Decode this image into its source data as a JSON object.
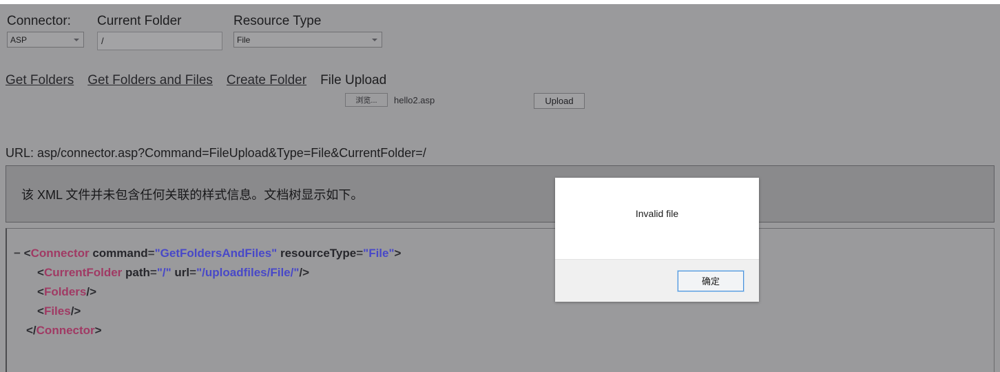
{
  "form": {
    "connector": {
      "label": "Connector:",
      "value": "ASP"
    },
    "current_folder": {
      "label": "Current Folder",
      "value": "/"
    },
    "resource_type": {
      "label": "Resource Type",
      "value": "File"
    }
  },
  "actions": {
    "get_folders": "Get Folders",
    "get_folders_and_files": "Get Folders and Files",
    "create_folder": "Create Folder",
    "file_upload_label": "File Upload",
    "browse_button": "浏览...",
    "selected_file": "hello2.asp",
    "upload_button": "Upload"
  },
  "url_line": "URL: asp/connector.asp?Command=FileUpload&Type=File&CurrentFolder=/",
  "xml_notice": "该 XML 文件并未包含任何关联的样式信息。文档树显示如下。",
  "xml": {
    "collapse_toggle": "−",
    "line1": {
      "open": "<",
      "tag": "Connector",
      "attr1": "command",
      "eq": "=",
      "val1": "\"GetFoldersAndFiles\"",
      "attr2": "resourceType",
      "val2": "\"File\"",
      "close": ">"
    },
    "line2": {
      "open": "<",
      "tag": "CurrentFolder",
      "attr1": "path",
      "eq": "=",
      "val1": "\"/\"",
      "attr2": "url",
      "val2": "\"/uploadfiles/File/\"",
      "close": "/>"
    },
    "line3": {
      "open": "<",
      "tag": "Folders",
      "close": "/>"
    },
    "line4": {
      "open": "<",
      "tag": "Files",
      "close": "/>"
    },
    "line5": {
      "open": "</",
      "tag": "Connector",
      "close": ">"
    }
  },
  "dialog": {
    "message": "Invalid file",
    "ok_button": "确定"
  },
  "colors": {
    "page_background": "#9a9a9c",
    "notice_background": "#8a8a8c",
    "xml_tag": "#a03a64",
    "xml_value": "#4848c8",
    "dialog_focus_border": "#4a90d9"
  }
}
